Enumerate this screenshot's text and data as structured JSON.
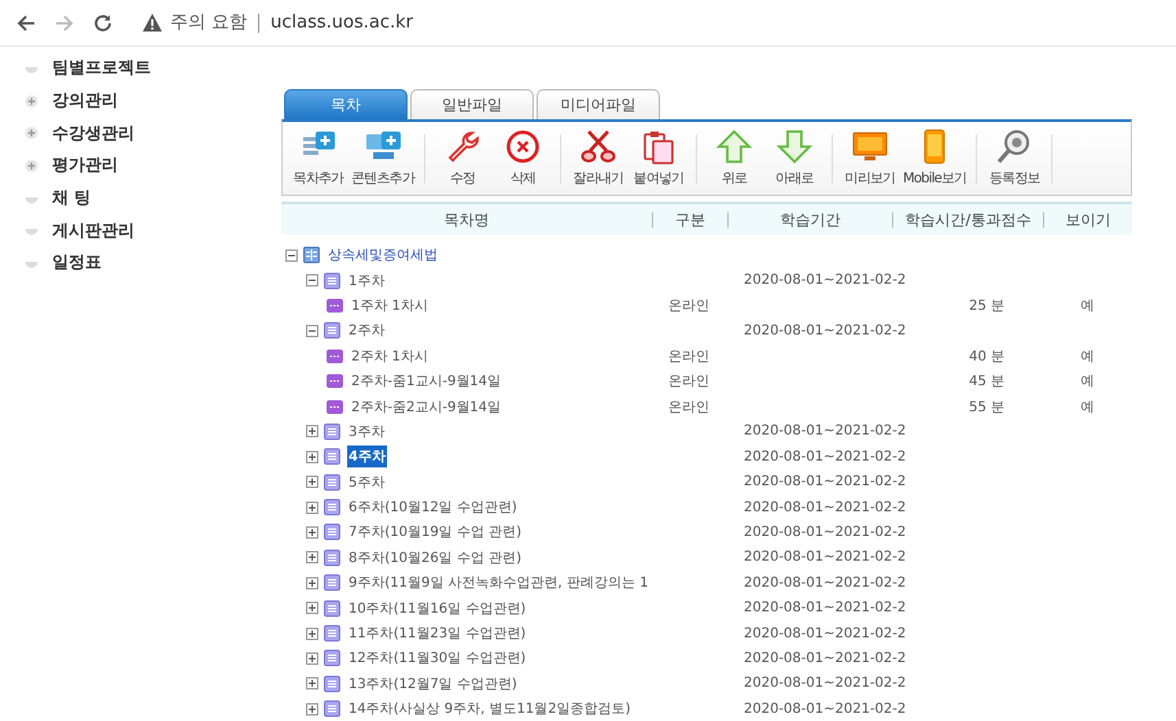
{
  "browser": {
    "security": "주의 요함",
    "url": "uclass.uos.ac.kr"
  },
  "sidebar": {
    "items": [
      {
        "label": "팀별프로젝트",
        "expandable": false
      },
      {
        "label": "강의관리",
        "expandable": true
      },
      {
        "label": "수강생관리",
        "expandable": true
      },
      {
        "label": "평가관리",
        "expandable": true
      },
      {
        "label": "채 팅",
        "expandable": false
      },
      {
        "label": "게시판관리",
        "expandable": false
      },
      {
        "label": "일정표",
        "expandable": false
      }
    ]
  },
  "tabs": [
    {
      "label": "목차",
      "selected": true
    },
    {
      "label": "일반파일",
      "selected": false
    },
    {
      "label": "미디어파일",
      "selected": false
    }
  ],
  "toolbar": [
    [
      {
        "label": "목차추가",
        "kind": "add-list"
      },
      {
        "label": "콘텐츠추가",
        "kind": "add-content"
      }
    ],
    [
      {
        "label": "수정",
        "kind": "wrench"
      },
      {
        "label": "삭제",
        "kind": "delete"
      }
    ],
    [
      {
        "label": "잘라내기",
        "kind": "cut"
      },
      {
        "label": "붙여넣기",
        "kind": "paste"
      }
    ],
    [
      {
        "label": "위로",
        "kind": "up"
      },
      {
        "label": "아래로",
        "kind": "down"
      }
    ],
    [
      {
        "label": "미리보기",
        "kind": "monitor"
      },
      {
        "label": "Mobile보기",
        "kind": "mobile"
      }
    ],
    [
      {
        "label": "등록정보",
        "kind": "magnifier"
      }
    ]
  ],
  "table": {
    "columns": [
      "목차명",
      "구분",
      "학습기간",
      "학습시간/통과점수",
      "보이기"
    ],
    "tree": [
      {
        "kind": "course",
        "name": "상속세및증여세법",
        "expanded": true,
        "selected": false,
        "children": [
          {
            "kind": "week",
            "name": "1주차",
            "period": "2020-08-01~2021-02-2",
            "expanded": true,
            "selected": false,
            "children": [
              {
                "kind": "content",
                "name": "1주차 1차시",
                "type": "온라인",
                "time": "25 분",
                "visible": "예",
                "selected": false
              }
            ]
          },
          {
            "kind": "week",
            "name": "2주차",
            "period": "2020-08-01~2021-02-2",
            "expanded": true,
            "selected": false,
            "children": [
              {
                "kind": "content",
                "name": "2주차 1차시",
                "type": "온라인",
                "time": "40 분",
                "visible": "예",
                "selected": false
              },
              {
                "kind": "content",
                "name": "2주차-줌1교시-9월14일",
                "type": "온라인",
                "time": "45 분",
                "visible": "예",
                "selected": false
              },
              {
                "kind": "content",
                "name": "2주차-줌2교시-9월14일",
                "type": "온라인",
                "time": "55 분",
                "visible": "예",
                "selected": false
              }
            ]
          },
          {
            "kind": "week",
            "name": "3주차",
            "period": "2020-08-01~2021-02-2",
            "expanded": false,
            "selected": false
          },
          {
            "kind": "week",
            "name": "4주차",
            "period": "2020-08-01~2021-02-2",
            "expanded": false,
            "selected": true
          },
          {
            "kind": "week",
            "name": "5주차",
            "period": "2020-08-01~2021-02-2",
            "expanded": false,
            "selected": false
          },
          {
            "kind": "week",
            "name": "6주차(10월12일 수업관련)",
            "period": "2020-08-01~2021-02-2",
            "expanded": false,
            "selected": false
          },
          {
            "kind": "week",
            "name": "7주차(10월19일 수업 관련)",
            "period": "2020-08-01~2021-02-2",
            "expanded": false,
            "selected": false
          },
          {
            "kind": "week",
            "name": "8주차(10월26일 수업 관련)",
            "period": "2020-08-01~2021-02-2",
            "expanded": false,
            "selected": false
          },
          {
            "kind": "week",
            "name": "9주차(11월9일 사전녹화수업관련, 판례강의는 1",
            "period": "2020-08-01~2021-02-2",
            "expanded": false,
            "selected": false
          },
          {
            "kind": "week",
            "name": "10주차(11월16일 수업관련)",
            "period": "2020-08-01~2021-02-2",
            "expanded": false,
            "selected": false
          },
          {
            "kind": "week",
            "name": "11주차(11월23일 수업관련)",
            "period": "2020-08-01~2021-02-2",
            "expanded": false,
            "selected": false
          },
          {
            "kind": "week",
            "name": "12주차(11월30일 수업관련)",
            "period": "2020-08-01~2021-02-2",
            "expanded": false,
            "selected": false
          },
          {
            "kind": "week",
            "name": "13주차(12월7일 수업관련)",
            "period": "2020-08-01~2021-02-2",
            "expanded": false,
            "selected": false
          },
          {
            "kind": "week",
            "name": "14주차(사실상 9주차, 별도11월2일종합검토)",
            "period": "2020-08-01~2021-02-2",
            "expanded": false,
            "selected": false
          }
        ]
      }
    ]
  }
}
